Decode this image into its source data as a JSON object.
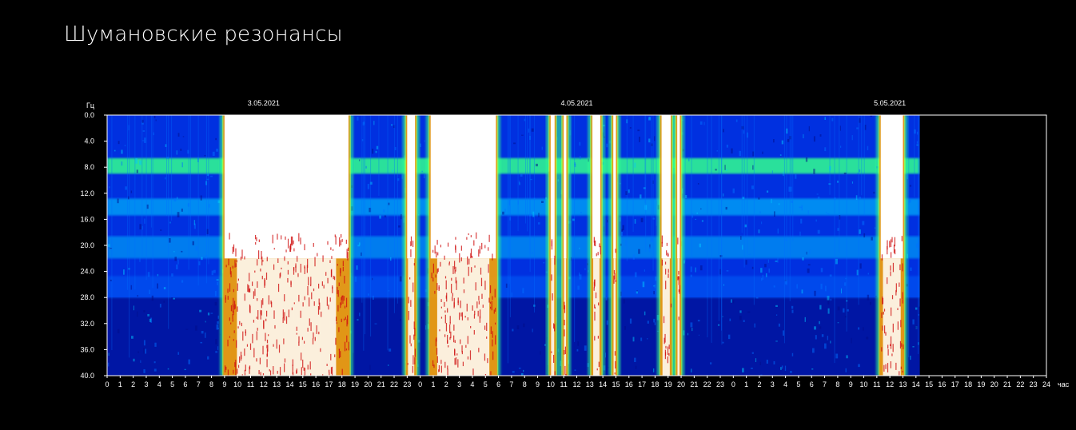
{
  "page": {
    "title": "Шумановские резонансы"
  },
  "chart_data": {
    "type": "heatmap",
    "title": "",
    "ylabel": "Гц",
    "xlabel": "час",
    "ylim": [
      0,
      40
    ],
    "y_inverted": true,
    "y_ticks": [
      "0.0",
      "4.0",
      "8.0",
      "12.0",
      "16.0",
      "20.0",
      "24.0",
      "28.0",
      "32.0",
      "36.0",
      "40.0"
    ],
    "dates": [
      "3.05.2021",
      "4.05.2021",
      "5.05.2021"
    ],
    "x_ticks": [
      "0",
      "1",
      "2",
      "3",
      "4",
      "5",
      "6",
      "7",
      "8",
      "9",
      "10",
      "11",
      "12",
      "13",
      "14",
      "15",
      "16",
      "17",
      "18",
      "19",
      "20",
      "21",
      "22",
      "23",
      "0",
      "1",
      "2",
      "3",
      "4",
      "5",
      "6",
      "7",
      "8",
      "9",
      "10",
      "11",
      "12",
      "13",
      "14",
      "15",
      "16",
      "17",
      "18",
      "19",
      "20",
      "21",
      "22",
      "23",
      "0",
      "1",
      "2",
      "3",
      "4",
      "5",
      "6",
      "7",
      "8",
      "9",
      "10",
      "11",
      "12",
      "13",
      "14",
      "15",
      "16",
      "17",
      "18",
      "19",
      "20",
      "21",
      "22",
      "23",
      "24"
    ],
    "data_end_hour": 62.3,
    "resonance_bands_hz": [
      7.8,
      14.1,
      20.3,
      26.4
    ],
    "high_intensity_intervals_h": [
      [
        9.0,
        18.5
      ],
      [
        23.0,
        23.6
      ],
      [
        24.8,
        29.8
      ],
      [
        34.0,
        34.3
      ],
      [
        35.0,
        35.2
      ],
      [
        37.2,
        37.8
      ],
      [
        38.8,
        39.0
      ],
      [
        42.5,
        43.2
      ],
      [
        43.7,
        43.9
      ],
      [
        59.3,
        61.0
      ]
    ],
    "colormap": [
      "#000c8a",
      "#0030e0",
      "#0070ff",
      "#00c8ff",
      "#30ff90",
      "#d0ff30",
      "#ff8000",
      "#d01010",
      "#ffffff"
    ]
  }
}
